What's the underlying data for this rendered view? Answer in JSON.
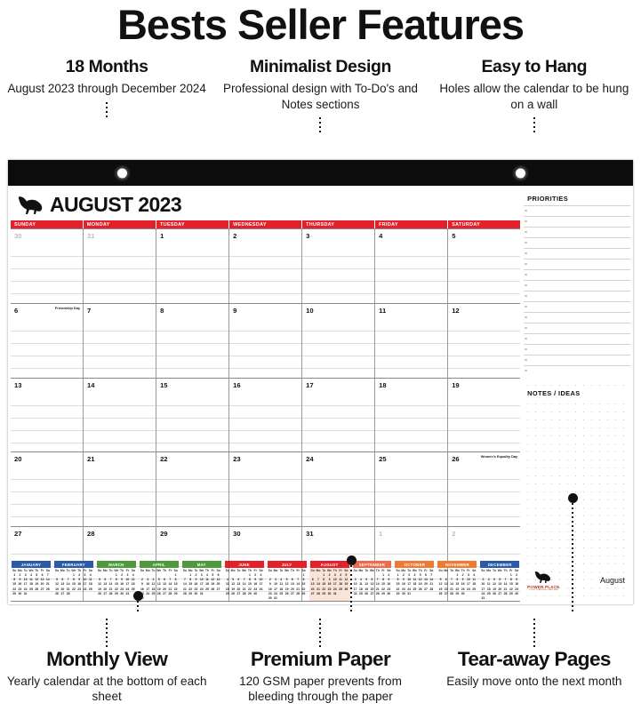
{
  "header": {
    "title": "Bests Seller Features"
  },
  "top_features": [
    {
      "title": "18 Months",
      "desc": "August 2023 through\nDecember 2024"
    },
    {
      "title": "Minimalist Design",
      "desc": "Professional design with\nTo-Do's and Notes sections"
    },
    {
      "title": "Easy to Hang",
      "desc": "Holes allow the calendar\nto be hung on a wall"
    }
  ],
  "bottom_features": [
    {
      "title": "Monthly View",
      "desc": "Yearly calendar\nat the bottom of each sheet"
    },
    {
      "title": "Premium Paper",
      "desc": "120 GSM paper prevents from\nbleeding through the paper"
    },
    {
      "title": "Tear-away Pages",
      "desc": "Easily move\nonto the next month"
    }
  ],
  "calendar": {
    "month_title": "AUGUST 2023",
    "logo_icon": "running-horse-icon",
    "weekdays": [
      "SUNDAY",
      "MONDAY",
      "TUESDAY",
      "WEDNESDAY",
      "THURSDAY",
      "FRIDAY",
      "SATURDAY"
    ],
    "accent_color": "#e5202b",
    "weeks": [
      [
        {
          "n": "30",
          "out": true,
          "holiday": ""
        },
        {
          "n": "31",
          "out": true,
          "holiday": ""
        },
        {
          "n": "1",
          "out": false,
          "holiday": ""
        },
        {
          "n": "2",
          "out": false,
          "holiday": ""
        },
        {
          "n": "3",
          "out": false,
          "holiday": ""
        },
        {
          "n": "4",
          "out": false,
          "holiday": ""
        },
        {
          "n": "5",
          "out": false,
          "holiday": ""
        }
      ],
      [
        {
          "n": "6",
          "out": false,
          "holiday": "Friendship Day"
        },
        {
          "n": "7",
          "out": false,
          "holiday": ""
        },
        {
          "n": "8",
          "out": false,
          "holiday": ""
        },
        {
          "n": "9",
          "out": false,
          "holiday": ""
        },
        {
          "n": "10",
          "out": false,
          "holiday": ""
        },
        {
          "n": "11",
          "out": false,
          "holiday": ""
        },
        {
          "n": "12",
          "out": false,
          "holiday": ""
        }
      ],
      [
        {
          "n": "13",
          "out": false,
          "holiday": ""
        },
        {
          "n": "14",
          "out": false,
          "holiday": ""
        },
        {
          "n": "15",
          "out": false,
          "holiday": ""
        },
        {
          "n": "16",
          "out": false,
          "holiday": ""
        },
        {
          "n": "17",
          "out": false,
          "holiday": ""
        },
        {
          "n": "18",
          "out": false,
          "holiday": ""
        },
        {
          "n": "19",
          "out": false,
          "holiday": ""
        }
      ],
      [
        {
          "n": "20",
          "out": false,
          "holiday": ""
        },
        {
          "n": "21",
          "out": false,
          "holiday": ""
        },
        {
          "n": "22",
          "out": false,
          "holiday": ""
        },
        {
          "n": "23",
          "out": false,
          "holiday": ""
        },
        {
          "n": "24",
          "out": false,
          "holiday": ""
        },
        {
          "n": "25",
          "out": false,
          "holiday": ""
        },
        {
          "n": "26",
          "out": false,
          "holiday": "Women's Equality\nDay"
        }
      ],
      [
        {
          "n": "27",
          "out": false,
          "holiday": ""
        },
        {
          "n": "28",
          "out": false,
          "holiday": ""
        },
        {
          "n": "29",
          "out": false,
          "holiday": ""
        },
        {
          "n": "30",
          "out": false,
          "holiday": ""
        },
        {
          "n": "31",
          "out": false,
          "holiday": ""
        },
        {
          "n": "1",
          "out": true,
          "holiday": ""
        },
        {
          "n": "2",
          "out": true,
          "holiday": ""
        }
      ]
    ],
    "priorities_title": "PRIORITIES",
    "notes_title": "NOTES / IDEAS",
    "brand_name": "POWER PLACE",
    "brand_sub": "YOUR PLANNING PARTNER",
    "brand_month": "August"
  },
  "mini_year": {
    "dow": [
      "Su",
      "Mo",
      "Tu",
      "We",
      "Th",
      "Fr",
      "Sa"
    ],
    "months": [
      {
        "name": "JANUARY",
        "color": "#2b5ba8",
        "highlight": false,
        "start": 0,
        "days": 31
      },
      {
        "name": "FEBRUARY",
        "color": "#2b5ba8",
        "highlight": false,
        "start": 3,
        "days": 28
      },
      {
        "name": "MARCH",
        "color": "#4e9a3c",
        "highlight": false,
        "start": 3,
        "days": 31
      },
      {
        "name": "APRIL",
        "color": "#4e9a3c",
        "highlight": false,
        "start": 6,
        "days": 30
      },
      {
        "name": "MAY",
        "color": "#4e9a3c",
        "highlight": false,
        "start": 1,
        "days": 31
      },
      {
        "name": "JUNE",
        "color": "#e5202b",
        "highlight": false,
        "start": 4,
        "days": 30
      },
      {
        "name": "JULY",
        "color": "#e5202b",
        "highlight": false,
        "start": 6,
        "days": 31
      },
      {
        "name": "AUGUST",
        "color": "#e5202b",
        "highlight": true,
        "start": 2,
        "days": 31
      },
      {
        "name": "SEPTEMBER",
        "color": "#ef6a4c",
        "highlight": false,
        "start": 5,
        "days": 30
      },
      {
        "name": "OCTOBER",
        "color": "#ef7a33",
        "highlight": false,
        "start": 0,
        "days": 31
      },
      {
        "name": "NOVEMBER",
        "color": "#ef7a33",
        "highlight": false,
        "start": 3,
        "days": 30
      },
      {
        "name": "DECEMBER",
        "color": "#2b5ba8",
        "highlight": false,
        "start": 5,
        "days": 31
      }
    ]
  }
}
